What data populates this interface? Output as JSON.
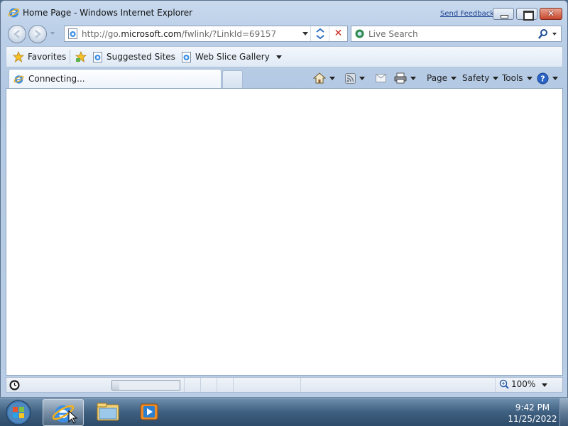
{
  "window": {
    "title": "Home Page - Windows Internet Explorer",
    "send_feedback": "Send Feedback"
  },
  "address": {
    "url_prefix": "http://go.",
    "url_domain": "microsoft.com",
    "url_path": "/fwlink/?LinkId=69157"
  },
  "search": {
    "placeholder": "Live Search"
  },
  "favorites_bar": {
    "favorites_label": "Favorites",
    "suggested_sites_label": "Suggested Sites",
    "web_slice_gallery_label": "Web Slice Gallery"
  },
  "tab": {
    "label": "Connecting..."
  },
  "command_bar": {
    "page_label": "Page",
    "safety_label": "Safety",
    "tools_label": "Tools"
  },
  "status_bar": {
    "zoom": "100%",
    "progress": 0.1
  },
  "taskbar": {
    "time": "9:42 PM",
    "date": "11/25/2022"
  },
  "icons": {
    "ie_logo": "ie-logo-icon",
    "back": "back-arrow-icon",
    "forward": "forward-arrow-icon",
    "refresh": "refresh-icon",
    "stop": "stop-icon",
    "search": "search-icon",
    "favorites_star": "favorites-star-icon",
    "home": "home-icon",
    "feeds": "rss-feed-icon",
    "mail": "mail-icon",
    "print": "print-icon",
    "help": "help-icon",
    "zoom": "zoom-icon",
    "start": "windows-start-icon"
  },
  "colors": {
    "accent": "#1a3f8c",
    "close_button": "#c7452b"
  }
}
